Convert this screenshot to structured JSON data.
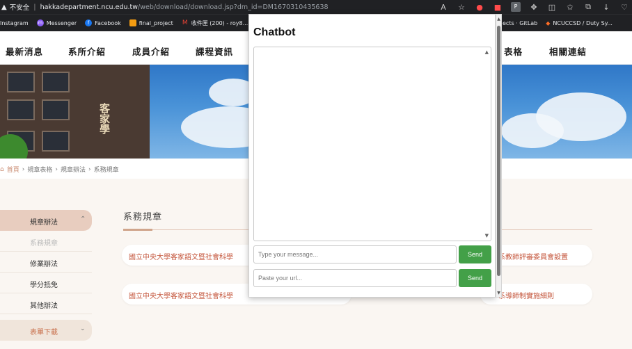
{
  "browser": {
    "security_label": "不安全",
    "url_domain": "hakkadepartment.ncu.edu.tw",
    "url_path": "/web/download/download.jsp?dm_id=DM1670310435638",
    "bookmarks": [
      "Instagram",
      "Messenger",
      "Facebook",
      "final_project",
      "收件匣 (200) - roy8..."
    ],
    "bookmarks_right": [
      "ects · GitLab",
      "NCUCCSD / Duty Sy..."
    ],
    "extension_icons": [
      "reader-mode-icon",
      "star-icon",
      "stop-icon",
      "record-icon",
      "p-extension-icon",
      "puzzle-icon",
      "split-icon",
      "favorites-icon",
      "collections-icon",
      "download-icon",
      "heart-icon"
    ]
  },
  "site": {
    "nav": [
      "最新消息",
      "系所介紹",
      "成員介紹",
      "課程資訊",
      "表格",
      "相關連結"
    ],
    "banner_sign": "客家學",
    "breadcrumb": [
      "首頁",
      "規章表格",
      "規章辦法",
      "系務規章"
    ],
    "sidebar": {
      "head": "規章辦法",
      "items": [
        "系務規章",
        "修業辦法",
        "學分抵免",
        "其他辦法"
      ],
      "foot": "表單下載"
    },
    "section_title": "系務規章",
    "documents": [
      "國立中央大學客家語文暨社會科學",
      "系教師評審委員會設置",
      "國立中央大學客家語文暨社會科學",
      "系導師制實施細則"
    ]
  },
  "chatbot": {
    "title": "Chatbot",
    "message_placeholder": "Type your message...",
    "url_placeholder": "Paste your url...",
    "send_label": "Send",
    "send_url_label": "Send"
  },
  "colors": {
    "chrome_bg": "#202124",
    "accent_green": "#43a048",
    "sidebar_active": "#e8cdbf",
    "link_red": "#c4553b"
  }
}
